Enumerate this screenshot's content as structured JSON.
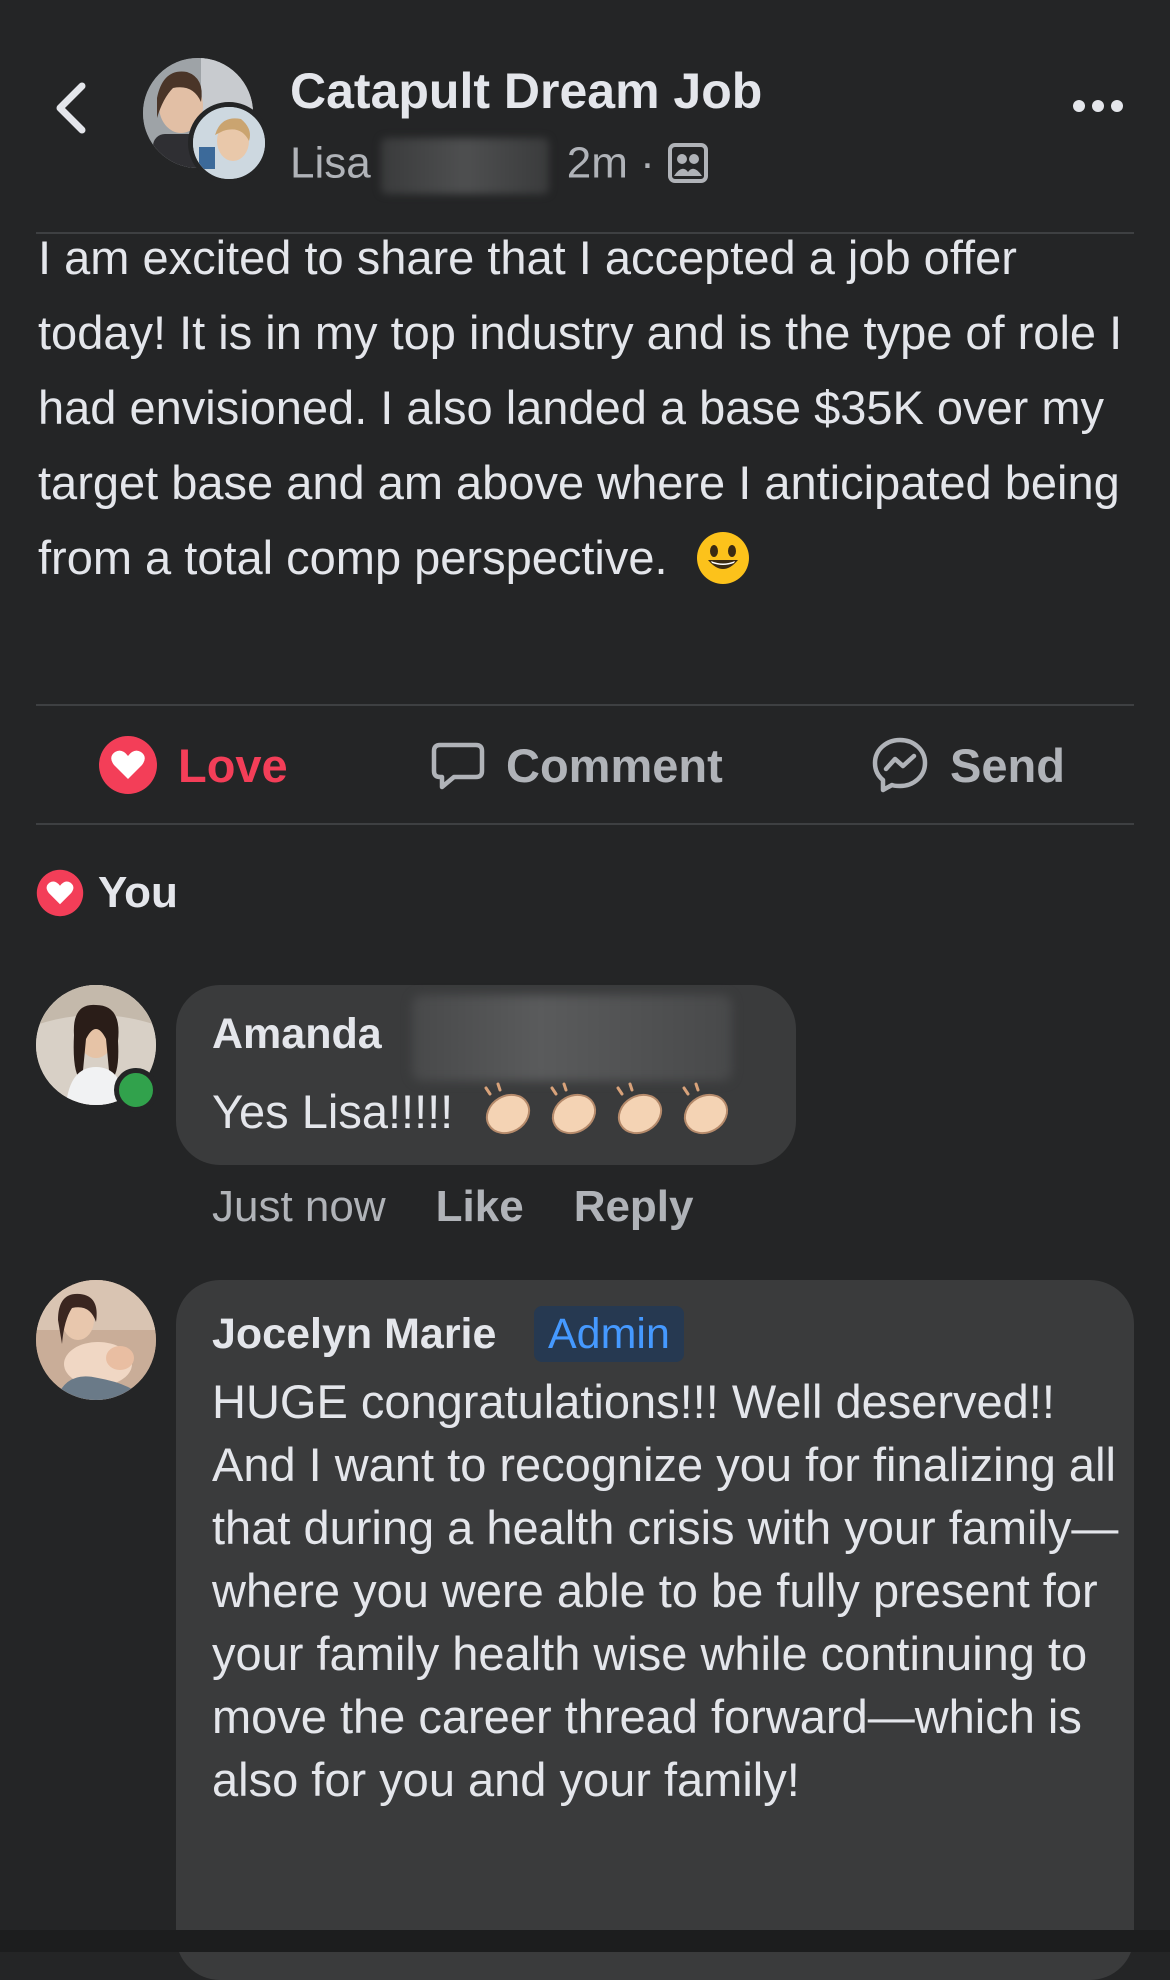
{
  "header": {
    "group_name": "Catapult Dream Job",
    "author_first": "Lisa",
    "time": "2m",
    "separator": "·",
    "audience_icon": "group-audience-icon"
  },
  "post": {
    "text": "I am excited to share that I accepted a job offer today! It is in my top industry and is the type of role I had envisioned. I also landed a base $35K over my target base and am above where I anticipated being from a total comp perspective.",
    "emoji": "smiley-face-icon"
  },
  "actions": {
    "love_label": "Love",
    "comment_label": "Comment",
    "send_label": "Send"
  },
  "reactions": {
    "label": "You"
  },
  "comments": [
    {
      "author": "Amanda",
      "text": "Yes Lisa!!!!!",
      "time": "Just now",
      "like_label": "Like",
      "reply_label": "Reply"
    },
    {
      "author": "Jocelyn Marie",
      "badge": "Admin",
      "text": "HUGE congratulations!!! Well deserved!! And I want to recognize you for finalizing all that during a health crisis with your family—where you were able to be fully present for your family health wise while continuing to move the career thread forward—which is also for you and your family!"
    }
  ],
  "colors": {
    "background": "#242526",
    "bubble": "#3a3b3c",
    "love": "#f33e58",
    "admin_badge_text": "#4599ff",
    "online": "#31a24c"
  }
}
